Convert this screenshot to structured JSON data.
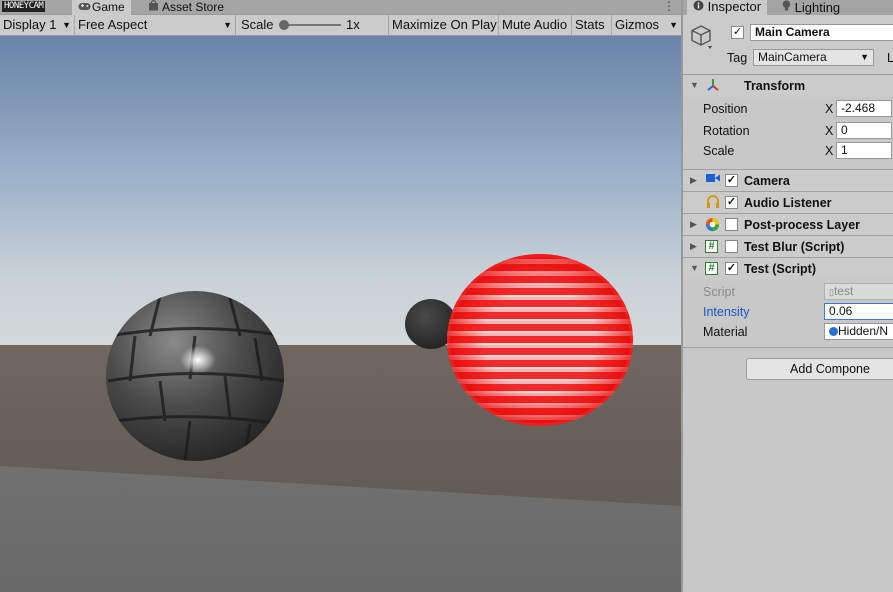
{
  "watermark": "HONEYCAM",
  "game_tabs": {
    "game": "Game",
    "asset_store": "Asset Store"
  },
  "game_toolbar": {
    "display": "Display 1",
    "aspect": "Free Aspect",
    "scale_label": "Scale",
    "scale_value": "1x",
    "maximize_on_play": "Maximize On Play",
    "mute_audio": "Mute Audio",
    "stats": "Stats",
    "gizmos": "Gizmos"
  },
  "inspector_tabs": {
    "inspector": "Inspector",
    "lighting": "Lighting"
  },
  "object": {
    "active": true,
    "name": "Main Camera",
    "tag_label": "Tag",
    "tag_value": "MainCamera",
    "layer_label_partial": "L"
  },
  "transform": {
    "title": "Transform",
    "position_label": "Position",
    "rotation_label": "Rotation",
    "scale_label": "Scale",
    "x_label": "X",
    "position_x": "-2.468",
    "rotation_x": "0",
    "scale_x": "1"
  },
  "components": [
    {
      "title": "Camera",
      "enabled": true,
      "icon": "camera-icon",
      "color": "#1f5fd6"
    },
    {
      "title": "Audio Listener",
      "enabled": true,
      "icon": "headphones-icon",
      "color": "#d89400"
    },
    {
      "title": "Post-process Layer",
      "enabled": false,
      "icon": "color-wheel-icon",
      "color": "#e05a1a"
    },
    {
      "title": "Test Blur (Script)",
      "enabled": false,
      "icon": "script-icon",
      "color": "#2e7d32"
    },
    {
      "title": "Test (Script)",
      "enabled": true,
      "icon": "script-icon",
      "color": "#2e7d32"
    }
  ],
  "test_script": {
    "script_label": "Script",
    "script_value": "test",
    "intensity_label": "Intensity",
    "intensity_value": "0.06",
    "material_label": "Material",
    "material_value": "Hidden/N"
  },
  "add_component": "Add Compone",
  "colors": {
    "accent_blue": "#1a56c8",
    "sphere_red": "#e82525",
    "sky_top": "#6b85ab"
  }
}
